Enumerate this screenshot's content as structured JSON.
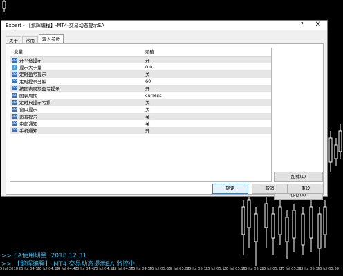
{
  "dialog": {
    "title": "Expert - 【鹅辉编程】-MT4-交易动态提示EA",
    "help": "?",
    "close": "✕"
  },
  "tabs": [
    {
      "label": "关于",
      "active": false
    },
    {
      "label": "常用",
      "active": false
    },
    {
      "label": "输入参数",
      "active": true
    }
  ],
  "table": {
    "headers": [
      "变量",
      "赋值"
    ],
    "rows": [
      {
        "icon": "ab-icon",
        "name": "开平仓提示",
        "value": "开"
      },
      {
        "icon": "v2-icon",
        "name": "提示大于量",
        "value": "0.0"
      },
      {
        "icon": "ab-icon",
        "name": "定时盈亏提示",
        "value": "关"
      },
      {
        "icon": "ab-icon",
        "name": "定时提示分钟",
        "value": "60"
      },
      {
        "icon": "ab-icon",
        "name": "按图表周期盈亏提示",
        "value": "开"
      },
      {
        "icon": "ab-icon",
        "name": "图表周期",
        "value": "current"
      },
      {
        "icon": "ab-icon",
        "name": "定时只提示亏损",
        "value": "关"
      },
      {
        "icon": "ab-icon",
        "name": "窗口提示",
        "value": "关"
      },
      {
        "icon": "ab-icon",
        "name": "声音提示",
        "value": "关"
      },
      {
        "icon": "ab-icon",
        "name": "电邮通知",
        "value": "关"
      },
      {
        "icon": "ab-icon",
        "name": "手机通知",
        "value": "开"
      }
    ]
  },
  "buttons": {
    "load": "加载(L)",
    "save": "保存(S)",
    "ok": "确定",
    "cancel": "取消",
    "reset": "重设"
  },
  "status": {
    "line1": ">>  EA使用期至: 2018.12.31",
    "line2": ">>  【鹅辉编程】-MT4-交易动态提示EA 监控中..."
  },
  "timeline": [
    "5 Jul 2018",
    "25 Jul 04:35",
    "25 Jul 04:39",
    "25 Jul 04:43",
    "25 Jul 04:47",
    "25 Jul 04:51",
    "25 Jul 04:55",
    "25 Jul 04:59",
    "25 Jul 05:03",
    "25 Jul 05:07",
    "25 Jul 05:11",
    "25 Jul 05:15",
    "25 Jul 05:19",
    "25 Jul 05:23",
    "25 Jul 05:27",
    "25 Jul 05:31",
    "25 Jul 05:35",
    "25 Jul 05:39"
  ],
  "colors": {
    "background": "#000000",
    "status_text": "#39b7e8",
    "candle": "#ffffff",
    "dialog": "#f0f0f0"
  }
}
